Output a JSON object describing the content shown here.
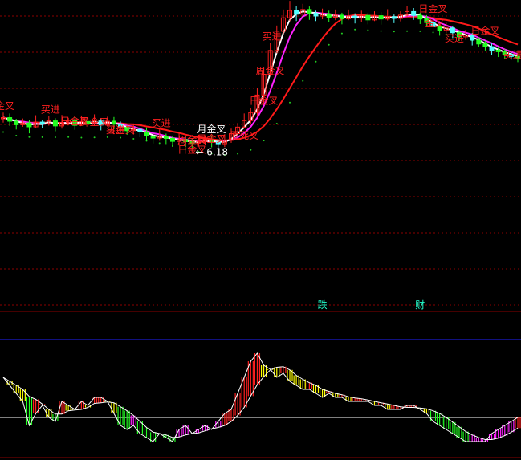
{
  "chart_data": [
    {
      "type": "candlestick",
      "title": "",
      "colors": {
        "up": "#ff2020",
        "down_cyan": "#54ffff",
        "down_green": "#22ff22",
        "ma_white": "#ffffff",
        "ma_magenta": "#ff22ff",
        "ma_red": "#ff1a1a",
        "dots": "#22cc22",
        "yellow": "#ffff00",
        "gridline": "#8b0000"
      },
      "grid": true,
      "x_count": 80,
      "ylim": [
        0,
        100
      ],
      "candles": [
        [
          60.0,
          60.4,
          62.1,
          58.7
        ],
        [
          60.4,
          59.2,
          61.8,
          57.6
        ],
        [
          59.2,
          58.0,
          60.0,
          56.4
        ],
        [
          58.0,
          58.6,
          60.1,
          57.3
        ],
        [
          58.6,
          57.3,
          59.6,
          55.1
        ],
        [
          57.3,
          58.9,
          61.2,
          56.8
        ],
        [
          58.9,
          58.4,
          59.6,
          57.0
        ],
        [
          58.4,
          59.3,
          61.0,
          57.7
        ],
        [
          59.3,
          57.6,
          60.2,
          55.8
        ],
        [
          57.6,
          58.7,
          61.3,
          56.7
        ],
        [
          58.7,
          59.4,
          60.3,
          57.8
        ],
        [
          59.4,
          57.8,
          60.9,
          56.3
        ],
        [
          57.8,
          59.1,
          61.1,
          57.6
        ],
        [
          59.1,
          58.4,
          60.0,
          56.8
        ],
        [
          58.4,
          59.3,
          61.5,
          57.6
        ],
        [
          59.3,
          57.9,
          60.1,
          56.1
        ],
        [
          57.9,
          59.2,
          60.7,
          57.4
        ],
        [
          59.2,
          58.2,
          60.6,
          56.5
        ],
        [
          58.2,
          57.1,
          59.1,
          55.3
        ],
        [
          57.1,
          56.0,
          57.8,
          54.6
        ],
        [
          56.0,
          56.4,
          58.4,
          54.7
        ],
        [
          56.4,
          55.6,
          57.4,
          53.8
        ],
        [
          55.6,
          54.2,
          57.1,
          52.5
        ],
        [
          54.2,
          53.5,
          55.1,
          51.7
        ],
        [
          53.5,
          54.1,
          56.4,
          52.6
        ],
        [
          54.1,
          53.4,
          55.0,
          51.5
        ],
        [
          53.4,
          52.4,
          54.2,
          50.7
        ],
        [
          52.4,
          53.0,
          55.2,
          51.0
        ],
        [
          53.0,
          52.3,
          53.9,
          50.5
        ],
        [
          52.3,
          51.8,
          53.2,
          50.0
        ],
        [
          51.8,
          52.4,
          54.6,
          50.9
        ],
        [
          52.4,
          53.1,
          54.3,
          51.2
        ],
        [
          53.1,
          52.2,
          54.4,
          50.4
        ],
        [
          52.2,
          51.6,
          53.1,
          49.9
        ],
        [
          51.6,
          52.8,
          54.8,
          50.5
        ],
        [
          52.8,
          55.0,
          56.7,
          51.9
        ],
        [
          55.0,
          57.2,
          58.6,
          54.3
        ],
        [
          57.2,
          59.4,
          61.8,
          56.8
        ],
        [
          59.4,
          62.1,
          63.5,
          58.4
        ],
        [
          62.1,
          68.0,
          70.4,
          61.0
        ],
        [
          68.0,
          75.0,
          77.1,
          66.8
        ],
        [
          75.0,
          83.0,
          85.6,
          74.4
        ],
        [
          83.0,
          89.5,
          91.4,
          82.1
        ],
        [
          89.5,
          94.0,
          96.8,
          88.6
        ],
        [
          94.0,
          96.5,
          99.7,
          92.9
        ],
        [
          96.5,
          95.2,
          97.9,
          92.9
        ],
        [
          95.2,
          96.8,
          98.7,
          94.6
        ],
        [
          96.8,
          95.5,
          97.8,
          93.3
        ],
        [
          95.5,
          94.6,
          96.4,
          92.9
        ],
        [
          94.6,
          95.3,
          97.1,
          93.5
        ],
        [
          95.3,
          94.2,
          96.4,
          92.5
        ],
        [
          94.2,
          94.9,
          96.8,
          93.2
        ],
        [
          94.9,
          93.7,
          95.7,
          91.8
        ],
        [
          93.7,
          94.6,
          96.8,
          93.2
        ],
        [
          94.6,
          93.9,
          95.5,
          92.1
        ],
        [
          93.9,
          94.8,
          96.4,
          92.6
        ],
        [
          94.8,
          93.3,
          95.7,
          91.8
        ],
        [
          93.3,
          94.7,
          96.2,
          92.9
        ],
        [
          94.7,
          93.6,
          95.9,
          91.7
        ],
        [
          93.6,
          94.4,
          96.9,
          93.1
        ],
        [
          94.4,
          93.8,
          95.1,
          92.2
        ],
        [
          93.8,
          94.9,
          96.2,
          92.8
        ],
        [
          94.9,
          96.1,
          97.9,
          94.4
        ],
        [
          96.1,
          94.8,
          97.3,
          93.3
        ],
        [
          94.8,
          93.6,
          95.7,
          91.9
        ],
        [
          93.6,
          92.4,
          94.9,
          91.0
        ],
        [
          92.4,
          91.0,
          93.2,
          89.1
        ],
        [
          91.0,
          89.8,
          92.0,
          88.0
        ],
        [
          89.8,
          90.6,
          92.7,
          88.8
        ],
        [
          90.6,
          89.0,
          91.3,
          87.2
        ],
        [
          89.0,
          87.6,
          89.8,
          86.2
        ],
        [
          87.6,
          88.2,
          90.0,
          86.6
        ],
        [
          88.2,
          86.5,
          88.9,
          84.7
        ],
        [
          86.5,
          85.2,
          87.4,
          84.1
        ],
        [
          85.2,
          84.3,
          86.2,
          83.0
        ],
        [
          84.3,
          83.1,
          85.4,
          81.4
        ],
        [
          83.1,
          82.6,
          84.3,
          80.8
        ],
        [
          82.6,
          81.7,
          83.5,
          80.1
        ],
        [
          81.7,
          81.0,
          82.6,
          79.9
        ],
        [
          81.0,
          80.5,
          82.2,
          79.1
        ]
      ],
      "annotations": [
        {
          "i": 0,
          "text": "金叉",
          "color": "#ff2020"
        },
        {
          "i": 10,
          "text": "日金叉",
          "color": "#ff2020"
        },
        {
          "i": 17,
          "text": "日金叉",
          "color": "#ff2020"
        },
        {
          "i": 7,
          "text": "买进",
          "color": "#ff2020"
        },
        {
          "i": 13,
          "text": "周金叉",
          "color": "#ff2020"
        },
        {
          "i": 17,
          "text": "买进",
          "color": "#ff2020"
        },
        {
          "i": 24,
          "text": "买进",
          "color": "#ff2020"
        },
        {
          "i": 31,
          "text": "日金叉",
          "color": "#ff2020"
        },
        {
          "i": 28,
          "text": "日金叉",
          "color": "#ff2020"
        },
        {
          "i": 31,
          "text": "月金叉",
          "color": "#ffffff"
        },
        {
          "i": 28,
          "text": "周金叉",
          "color": "#ff2020"
        },
        {
          "i": 36,
          "text": "周死叉",
          "color": "#ff2020"
        },
        {
          "i": 41,
          "text": "买进",
          "color": "#ff2020"
        },
        {
          "i": 40,
          "text": "周金叉",
          "color": "#ff2020"
        },
        {
          "i": 39,
          "text": "日金叉",
          "color": "#ff2020"
        },
        {
          "i": 65,
          "text": "日金叉",
          "color": "#ff2020"
        },
        {
          "i": 66,
          "text": "金叉",
          "color": "#ff2020"
        },
        {
          "i": 69,
          "text": "买进",
          "color": "#ff2020"
        },
        {
          "i": 73,
          "text": "日金叉",
          "color": "#ff2020"
        },
        {
          "i": 78,
          "text": "买进",
          "color": "#ff2020"
        }
      ],
      "price_marker": {
        "i": 30,
        "text": "6.18"
      },
      "signal_tags": [
        {
          "i": 49,
          "text": "跌"
        },
        {
          "i": 64,
          "text": "财"
        }
      ]
    },
    {
      "type": "bar",
      "title": "",
      "series": [
        {
          "values": [
            0.1,
            0.08,
            0.06,
            0.04,
            -0.02,
            0.01,
            0.03,
            0.0,
            -0.01,
            0.04,
            0.03,
            0.02,
            0.04,
            0.03,
            0.05,
            0.05,
            0.04,
            0.01,
            -0.02,
            -0.03,
            -0.02,
            -0.04,
            -0.05,
            -0.06,
            -0.04,
            -0.05,
            -0.06,
            -0.03,
            -0.02,
            -0.04,
            -0.03,
            -0.02,
            -0.03,
            -0.01,
            0.01,
            0.02,
            0.06,
            0.1,
            0.14,
            0.16,
            0.13,
            0.12,
            0.1,
            0.11,
            0.09,
            0.08,
            0.07,
            0.07,
            0.06,
            0.05,
            0.06,
            0.05,
            0.05,
            0.04,
            0.04,
            0.04,
            0.04,
            0.03,
            0.03,
            0.02,
            0.02,
            0.02,
            0.03,
            0.03,
            0.02,
            0.01,
            -0.01,
            -0.02,
            -0.03,
            -0.04,
            -0.05,
            -0.06,
            -0.06,
            -0.06,
            -0.06,
            -0.04,
            -0.03,
            -0.02,
            -0.01,
            0.0
          ]
        }
      ],
      "ylim": [
        -0.08,
        0.18
      ]
    }
  ]
}
